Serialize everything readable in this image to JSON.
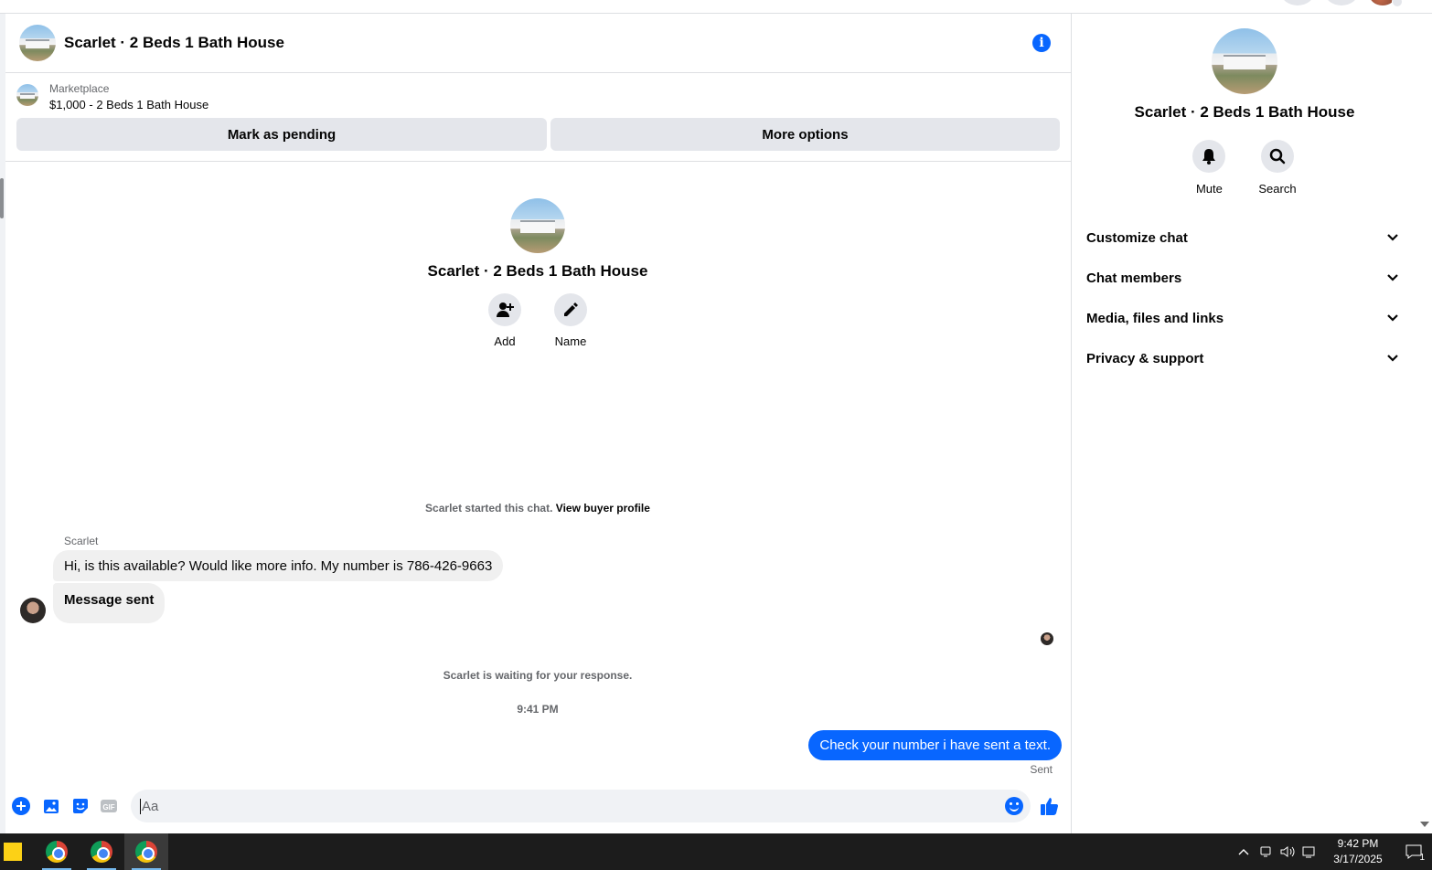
{
  "conversation": {
    "title": "Scarlet · 2 Beds 1 Bath House"
  },
  "listing": {
    "label": "Marketplace",
    "price_title": "$1,000 - 2 Beds 1 Bath House",
    "mark_pending_label": "Mark as pending",
    "more_options_label": "More options"
  },
  "intro": {
    "title": "Scarlet · 2 Beds 1 Bath House",
    "add_label": "Add",
    "name_label": "Name"
  },
  "thread": {
    "started_text": "Scarlet started this chat.",
    "view_buyer_link": "View buyer profile",
    "sender_name": "Scarlet",
    "incoming": [
      "Hi, is this available? Would like more info. My number is 786-426-9663",
      "Message sent"
    ],
    "waiting_text": "Scarlet is waiting for your response.",
    "timestamp": "9:41 PM",
    "outgoing": "Check your number i have sent a text.",
    "status": "Sent"
  },
  "composer": {
    "placeholder": "Aa",
    "gif_label": "GIF"
  },
  "side_panel": {
    "title": "Scarlet · 2 Beds 1 Bath House",
    "mute_label": "Mute",
    "search_label": "Search",
    "sections": [
      "Customize chat",
      "Chat members",
      "Media, files and links",
      "Privacy & support"
    ]
  },
  "taskbar": {
    "time": "9:42 PM",
    "date": "3/17/2025",
    "notification_count": "1"
  },
  "colors": {
    "accent": "#0866ff",
    "bubble_in": "#f0f0f0",
    "button_gray": "#e4e6eb",
    "secondary_text": "#65676b",
    "taskbar": "#1c1c1c"
  }
}
